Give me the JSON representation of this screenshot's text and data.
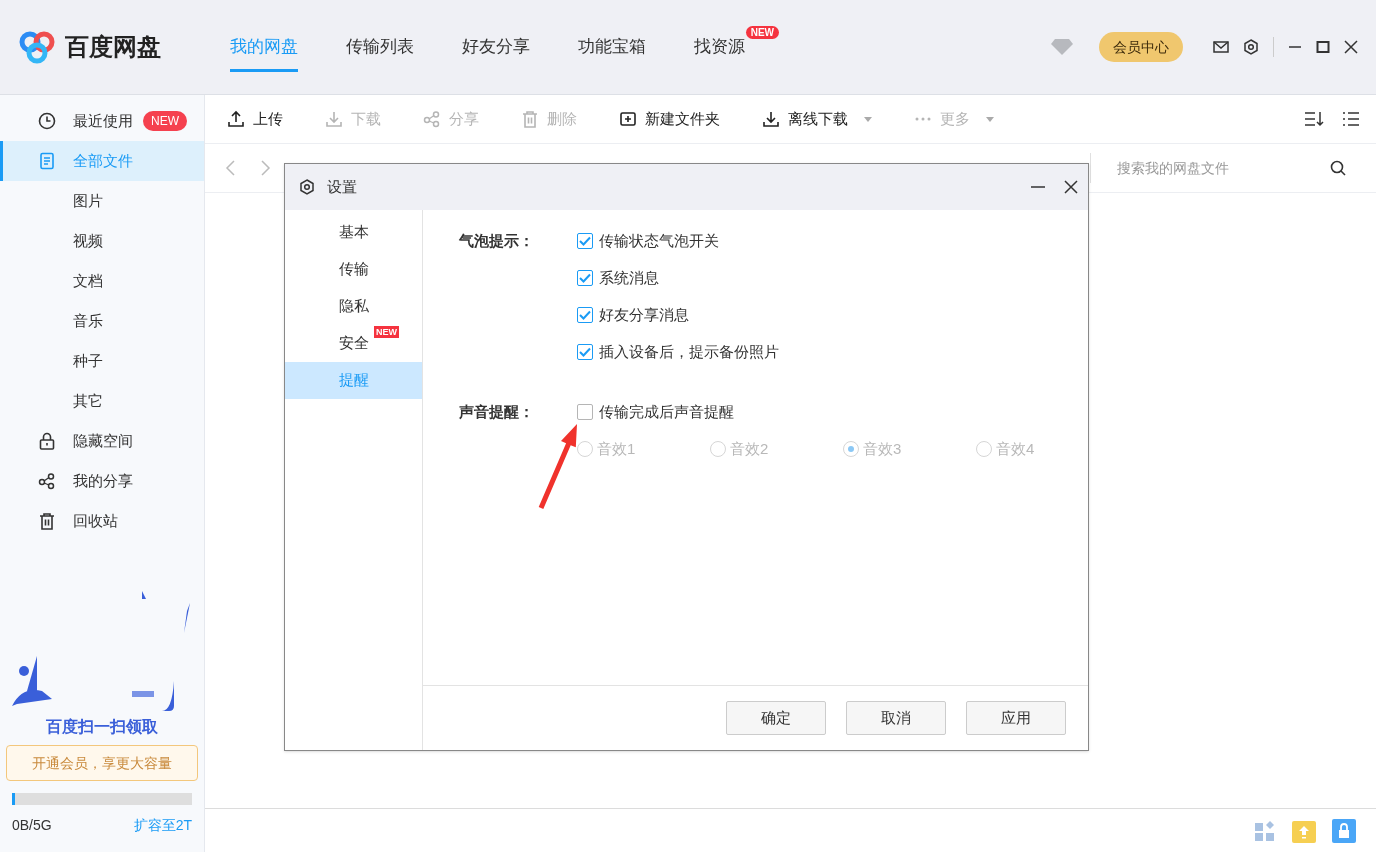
{
  "app": {
    "name": "百度网盘"
  },
  "tabs": [
    {
      "label": "我的网盘",
      "selected": true
    },
    {
      "label": "传输列表",
      "selected": false
    },
    {
      "label": "好友分享",
      "selected": false
    },
    {
      "label": "功能宝箱",
      "selected": false
    },
    {
      "label": "找资源",
      "selected": false,
      "badge": "NEW"
    }
  ],
  "vip_button": "会员中心",
  "sidebar": {
    "items": [
      {
        "label": "最近使用",
        "selected": false,
        "badge": "NEW"
      },
      {
        "label": "全部文件",
        "selected": true
      },
      {
        "label": "图片",
        "selected": false
      },
      {
        "label": "视频",
        "selected": false
      },
      {
        "label": "文档",
        "selected": false
      },
      {
        "label": "音乐",
        "selected": false
      },
      {
        "label": "种子",
        "selected": false
      },
      {
        "label": "其它",
        "selected": false
      },
      {
        "label": "隐藏空间",
        "selected": false
      },
      {
        "label": "我的分享",
        "selected": false
      },
      {
        "label": "回收站",
        "selected": false
      }
    ]
  },
  "ad": {
    "kind": "picture",
    "caption": "百度扫一扫领取"
  },
  "promo": "开通会员，享更大容量",
  "storage": {
    "level": 0.01,
    "used": "0B/5G",
    "expand_link": "扩容至2T"
  },
  "toolbar": {
    "items": [
      {
        "label": "上传",
        "disabled": false,
        "dropdown": false
      },
      {
        "label": "下载",
        "disabled": true,
        "dropdown": false
      },
      {
        "label": "分享",
        "disabled": true,
        "dropdown": false
      },
      {
        "label": "删除",
        "disabled": true,
        "dropdown": false
      },
      {
        "label": "新建文件夹",
        "disabled": false,
        "dropdown": false
      },
      {
        "label": "离线下载",
        "disabled": false,
        "dropdown": true
      },
      {
        "label": "更多",
        "disabled": true,
        "dropdown": true
      }
    ]
  },
  "search": {
    "placeholder": "搜索我的网盘文件"
  },
  "dialog": {
    "title": "设置",
    "nav": [
      {
        "label": "基本",
        "selected": false
      },
      {
        "label": "传输",
        "selected": false
      },
      {
        "label": "隐私",
        "selected": false
      },
      {
        "label": "安全",
        "selected": false,
        "badge": "NEW"
      },
      {
        "label": "提醒",
        "selected": true
      }
    ],
    "sections": [
      {
        "label": "气泡提示：",
        "options": [
          {
            "kind": "checkbox",
            "label": "传输状态气泡开关",
            "checked": true
          },
          {
            "kind": "checkbox",
            "label": "系统消息",
            "checked": true
          },
          {
            "kind": "checkbox",
            "label": "好友分享消息",
            "checked": true
          },
          {
            "kind": "checkbox",
            "label": "插入设备后，提示备份照片",
            "checked": true
          }
        ]
      },
      {
        "label": "声音提醒：",
        "options": [
          {
            "kind": "checkbox",
            "label": "传输完成后声音提醒",
            "checked": false
          },
          {
            "kind": "radio_group",
            "disabled": true,
            "choices": [
              {
                "label": "音效1",
                "selected": false
              },
              {
                "label": "音效2",
                "selected": false
              },
              {
                "label": "音效3",
                "selected": true
              },
              {
                "label": "音效4",
                "selected": false
              }
            ]
          }
        ]
      }
    ],
    "buttons": [
      "确定",
      "取消",
      "应用"
    ]
  }
}
